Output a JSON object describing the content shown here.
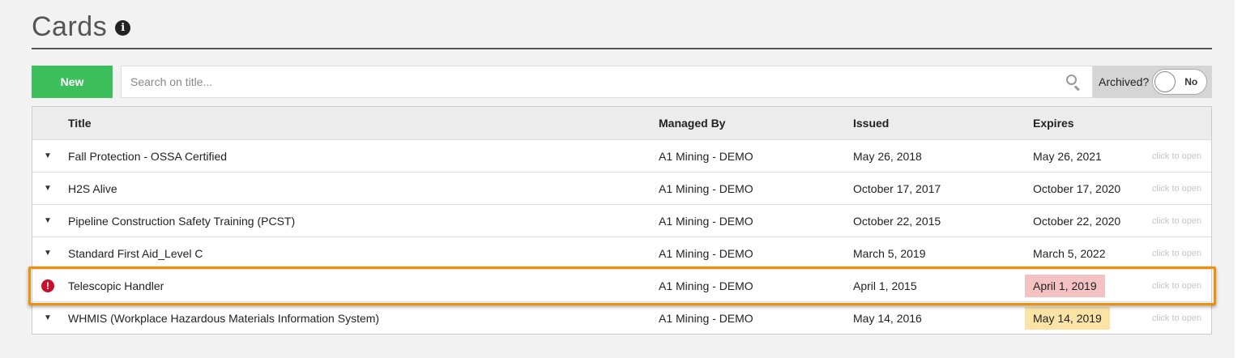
{
  "page": {
    "title": "Cards",
    "info_icon": "info-circle-icon"
  },
  "toolbar": {
    "new_label": "New",
    "search_placeholder": "Search on title...",
    "search_icon": "search-icon",
    "archived_label": "Archived?",
    "archived_toggle": "No"
  },
  "table": {
    "columns": {
      "title": "Title",
      "managed_by": "Managed By",
      "issued": "Issued",
      "expires": "Expires"
    },
    "rows": [
      {
        "title": "Fall Protection - OSSA Certified",
        "managed_by": "A1 Mining - DEMO",
        "issued": "May 26, 2018",
        "expires": "May 26, 2021",
        "action": "click to open",
        "expires_status": "ok"
      },
      {
        "title": "H2S Alive",
        "managed_by": "A1 Mining - DEMO",
        "issued": "October 17, 2017",
        "expires": "October 17, 2020",
        "action": "click to open",
        "expires_status": "ok"
      },
      {
        "title": "Pipeline Construction Safety Training (PCST)",
        "managed_by": "A1 Mining - DEMO",
        "issued": "October 22, 2015",
        "expires": "October 22, 2020",
        "action": "click to open",
        "expires_status": "ok"
      },
      {
        "title": "Standard First Aid_Level C",
        "managed_by": "A1 Mining - DEMO",
        "issued": "March 5, 2019",
        "expires": "March 5, 2022",
        "action": "click to open",
        "expires_status": "ok"
      },
      {
        "title": "Telescopic Handler",
        "managed_by": "A1 Mining - DEMO",
        "issued": "April 1, 2015",
        "expires": "April 1, 2019",
        "action": "click to open",
        "expires_status": "expired",
        "alert_glyph": "!"
      },
      {
        "title": "WHMIS (Workplace Hazardous Materials Information System)",
        "managed_by": "A1 Mining - DEMO",
        "issued": "May 14, 2016",
        "expires": "May 14, 2019",
        "action": "click to open",
        "expires_status": "warning"
      }
    ]
  },
  "colors": {
    "new_button": "#3dbf5b",
    "expired_badge": "#f5c2c4",
    "warning_badge": "#fbe3a6",
    "highlight": "#f0900a",
    "alert": "#c8102e"
  }
}
